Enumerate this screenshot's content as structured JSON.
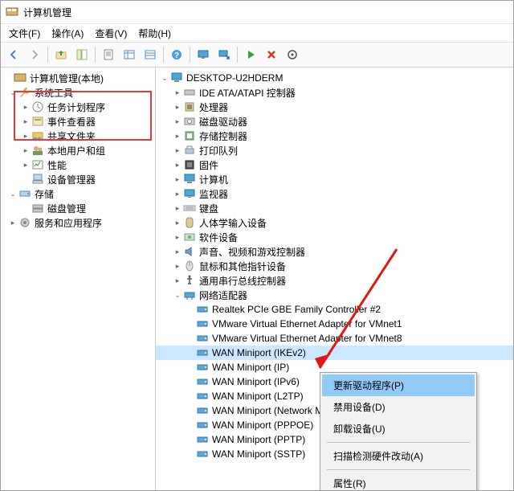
{
  "window": {
    "title": "计算机管理"
  },
  "menu": {
    "file": "文件(F)",
    "action": "操作(A)",
    "view": "查看(V)",
    "help": "帮助(H)"
  },
  "toolbar_icons": [
    "back",
    "forward",
    "up",
    "show-hide",
    "properties",
    "table",
    "list",
    "help",
    "monitor",
    "monitor-arrow",
    "green-play",
    "red-x",
    "target"
  ],
  "left_tree": {
    "root": "计算机管理(本地)",
    "system_tools": "系统工具",
    "task_scheduler": "任务计划程序",
    "event_viewer": "事件查看器",
    "shared_folders": "共享文件夹",
    "local_users": "本地用户和组",
    "performance": "性能",
    "device_manager": "设备管理器",
    "storage": "存储",
    "disk_mgmt": "磁盘管理",
    "services_apps": "服务和应用程序"
  },
  "right_tree": {
    "computer": "DESKTOP-U2HDERM",
    "ide": "IDE ATA/ATAPI 控制器",
    "cpu": "处理器",
    "disk": "磁盘驱动器",
    "storage_ctrl": "存储控制器",
    "print_queue": "打印队列",
    "firmware": "固件",
    "computers": "计算机",
    "monitors": "监视器",
    "keyboards": "键盘",
    "hid": "人体学输入设备",
    "software_dev": "软件设备",
    "audio": "声音、视频和游戏控制器",
    "mouse": "鼠标和其他指针设备",
    "usb": "通用串行总线控制器",
    "network": "网络适配器",
    "net_items": [
      "Realtek PCIe GBE Family Controller #2",
      "VMware Virtual Ethernet Adapter for VMnet1",
      "VMware Virtual Ethernet Adapter for VMnet8",
      "WAN Miniport (IKEv2)",
      "WAN Miniport (IP)",
      "WAN Miniport (IPv6)",
      "WAN Miniport (L2TP)",
      "WAN Miniport (Network Monitor)",
      "WAN Miniport (PPPOE)",
      "WAN Miniport (PPTP)",
      "WAN Miniport (SSTP)"
    ]
  },
  "context_menu": {
    "update_driver": "更新驱动程序(P)",
    "disable": "禁用设备(D)",
    "uninstall": "卸载设备(U)",
    "scan": "扫描检测硬件改动(A)",
    "properties": "属性(R)"
  }
}
